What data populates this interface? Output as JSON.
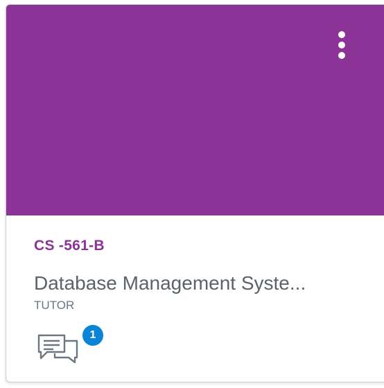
{
  "course_card": {
    "hero_color": "#8b3396",
    "menu_icon": "kebab-vertical-icon",
    "code": "CS -561-B",
    "name": "Database Management Syste...",
    "term": "TUTOR",
    "discussions": {
      "icon": "discussion-icon",
      "unread_count": "1",
      "badge_color": "#0a84d6"
    }
  }
}
